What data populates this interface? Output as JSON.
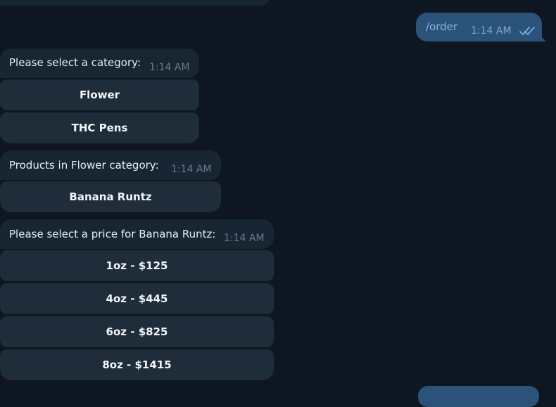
{
  "outgoing": {
    "text": "/order",
    "time": "1:14 AM",
    "status_icon": "double-check-icon"
  },
  "messages": [
    {
      "text": "Please select a category:",
      "time": "1:14 AM",
      "buttons": [
        "Flower",
        "THC Pens"
      ]
    },
    {
      "text": "Products in Flower category:",
      "time": "1:14 AM",
      "buttons": [
        "Banana Runtz"
      ]
    },
    {
      "text": "Please select a price for Banana Runtz:",
      "time": "1:14 AM",
      "buttons": [
        "1oz - $125",
        "4oz - $445",
        "6oz - $825",
        "8oz - $1415"
      ]
    }
  ],
  "colors": {
    "background": "#0e1621",
    "incoming_bubble": "#182533",
    "outgoing_bubble": "#2b5278",
    "keyboard_button": "#1f2c3a",
    "outgoing_text": "#8ab8e6",
    "check_marks": "#6fb1f0"
  }
}
